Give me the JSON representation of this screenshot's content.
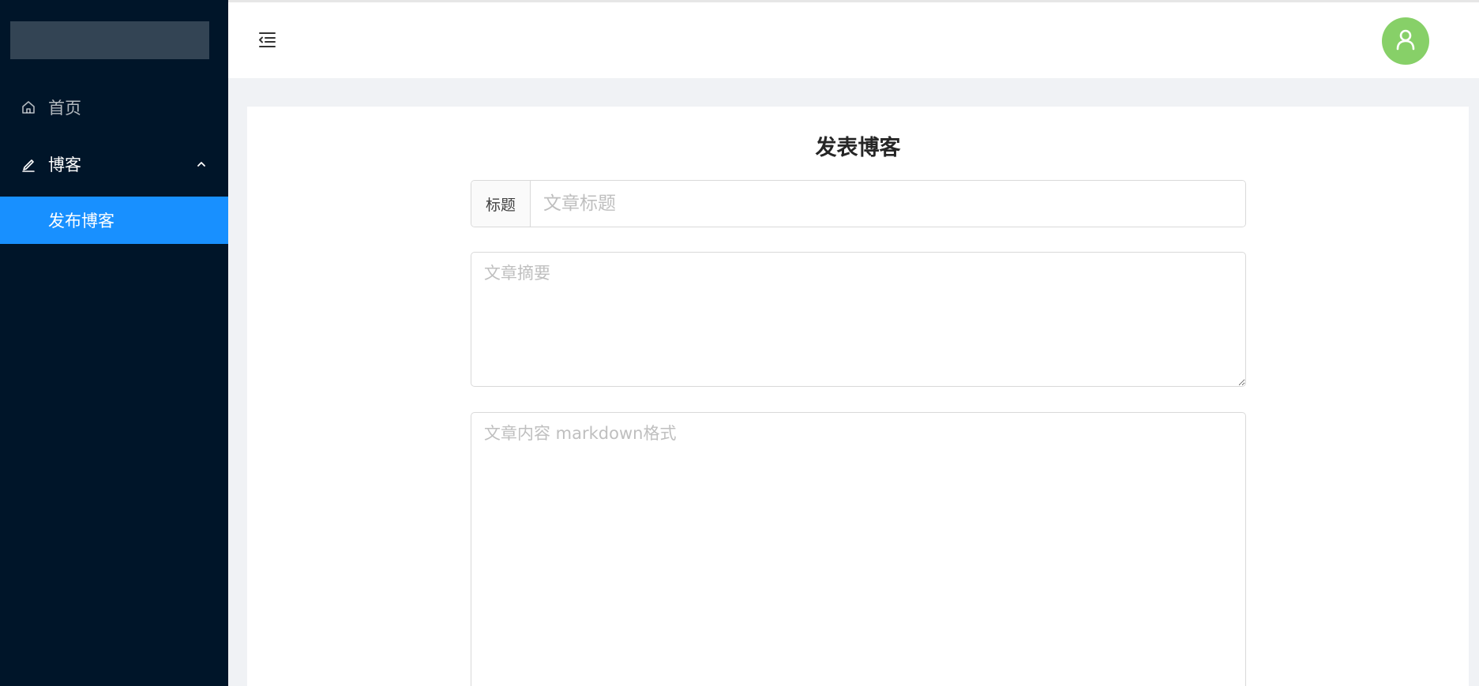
{
  "sidebar": {
    "items": [
      {
        "label": "首页",
        "icon": "home-icon"
      },
      {
        "label": "博客",
        "icon": "edit-icon",
        "expanded": true,
        "children": [
          {
            "label": "发布博客",
            "active": true
          }
        ]
      }
    ]
  },
  "header": {
    "collapse_icon": "menu-fold-icon",
    "avatar_icon": "user-icon"
  },
  "form": {
    "title": "发表博客",
    "title_addon": "标题",
    "title_placeholder": "文章标题",
    "summary_placeholder": "文章摘要",
    "content_placeholder": "文章内容 markdown格式"
  },
  "colors": {
    "sidebar_bg": "#001529",
    "active_item": "#1890ff",
    "avatar_bg": "#87d068",
    "content_bg": "#f0f2f5"
  }
}
